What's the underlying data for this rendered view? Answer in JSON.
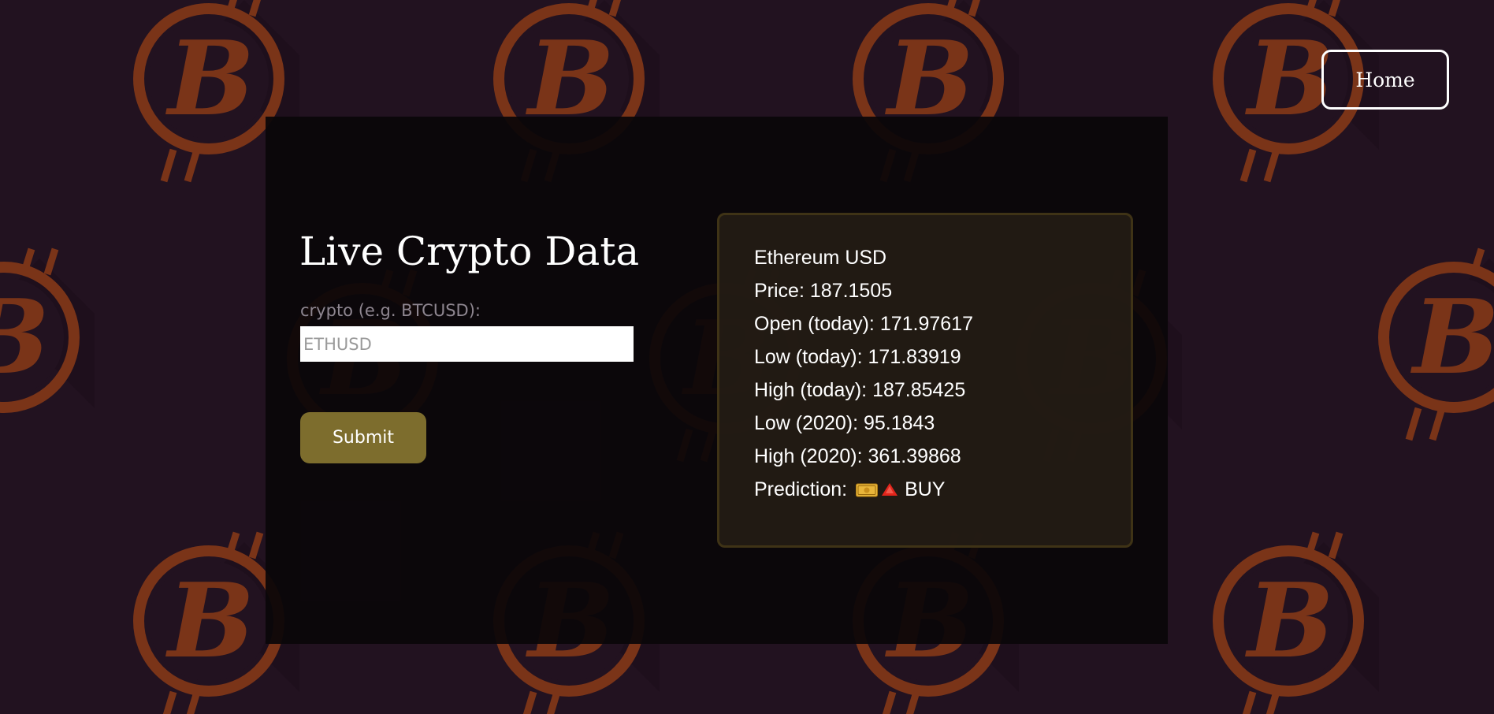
{
  "nav": {
    "home_label": "Home"
  },
  "form": {
    "title": "Live Crypto Data",
    "input_label": "crypto (e.g. BTCUSD):",
    "input_placeholder": "ETHUSD",
    "input_value": "",
    "submit_label": "Submit"
  },
  "result": {
    "name": "Ethereum USD",
    "rows": [
      {
        "label": "Price: ",
        "value": "187.1505"
      },
      {
        "label": "Open (today): ",
        "value": "171.97617"
      },
      {
        "label": "Low (today): ",
        "value": "171.83919"
      },
      {
        "label": "High (today): ",
        "value": "187.85425"
      },
      {
        "label": "Low (2020): ",
        "value": "95.1843"
      },
      {
        "label": "High (2020): ",
        "value": "361.39868"
      }
    ],
    "prediction_label": "Prediction: ",
    "prediction_value": "BUY",
    "prediction_icons": [
      "money-bill-icon",
      "red-up-triangle-icon"
    ]
  },
  "colors": {
    "background": "#221220",
    "coin": "#7a3418",
    "submit": "#7d6d2d",
    "card_border": "#3f3316"
  }
}
